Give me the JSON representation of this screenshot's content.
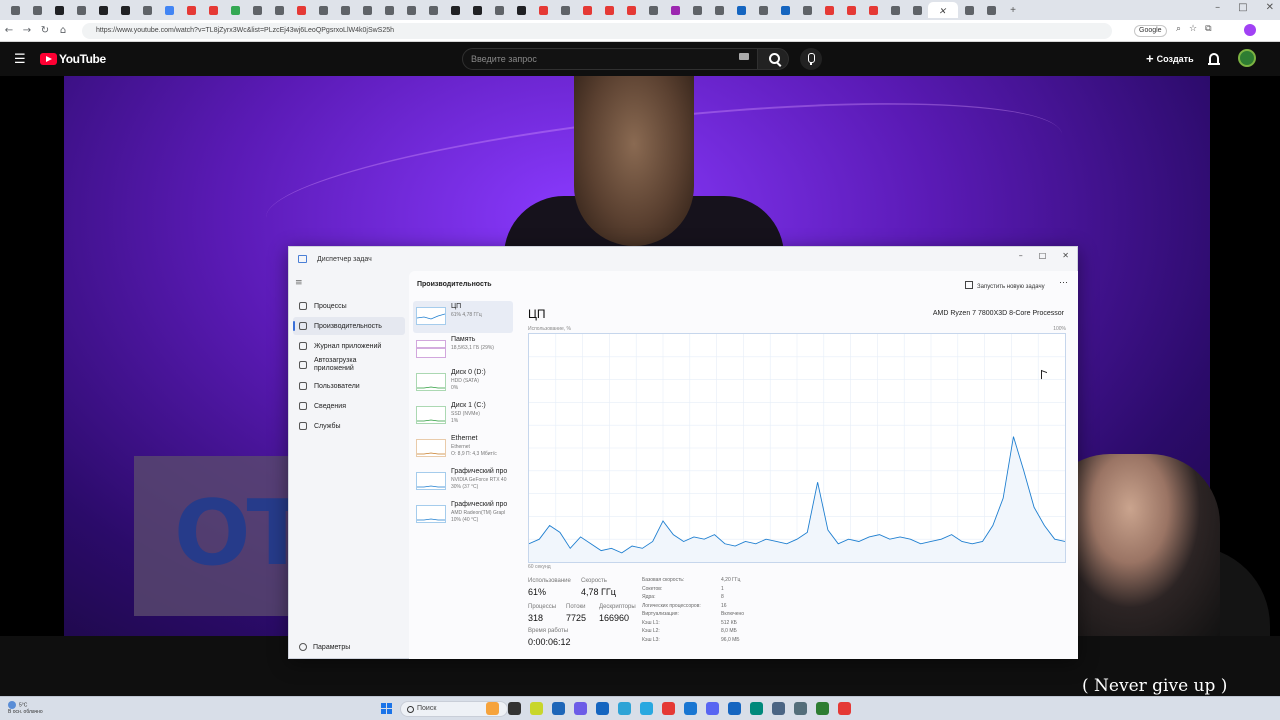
{
  "browser": {
    "url": "https://www.youtube.com/watch?v=TL8jZyrx3Wc&list=PLzcEj43wj6LeoQPgsrxoLlW4k0jSwS25h",
    "search_engine_chip": "Google",
    "tab_colors": [
      "#5f6368",
      "#5f6368",
      "#202124",
      "#5f6368",
      "#202124",
      "#202124",
      "#5f6368",
      "#4285f4",
      "#e53935",
      "#e53935",
      "#34a853",
      "#5f6368",
      "#5f6368",
      "#e53935",
      "#5f6368",
      "#5f6368",
      "#5f6368",
      "#5f6368",
      "#5f6368",
      "#5f6368",
      "#202124",
      "#202124",
      "#5f6368",
      "#202124",
      "#e53935",
      "#5f6368",
      "#e53935",
      "#e53935",
      "#e53935",
      "#5f6368",
      "#9c27b0",
      "#5f6368",
      "#5f6368",
      "#1565c0",
      "#5f6368",
      "#1565c0",
      "#5f6368",
      "#e53935",
      "#e53935",
      "#e53935",
      "#5f6368",
      "#5f6368",
      "#5f6368",
      "#5f6368",
      "#5f6368"
    ],
    "new_tab_label": "+"
  },
  "youtube": {
    "logo_text": "YouTube",
    "search_placeholder": "Введите запрос",
    "create_label": "Создать",
    "brand_color": "#ff0033"
  },
  "video": {
    "banner_text": "OT",
    "slogan": "( Never give up )"
  },
  "task_manager": {
    "title": "Диспетчер задач",
    "nav": [
      {
        "label": "Процессы",
        "icon": "processes-icon"
      },
      {
        "label": "Производительность",
        "icon": "performance-icon"
      },
      {
        "label": "Журнал приложений",
        "icon": "app-history-icon"
      },
      {
        "label": "Автозагрузка приложений",
        "icon": "startup-icon"
      },
      {
        "label": "Пользователи",
        "icon": "users-icon"
      },
      {
        "label": "Сведения",
        "icon": "details-icon"
      },
      {
        "label": "Службы",
        "icon": "services-icon"
      }
    ],
    "selected_nav": "Производительность",
    "settings_label": "Параметры",
    "panel_title": "Производительность",
    "new_task_label": "Запустить новую задачу",
    "devices": [
      {
        "name": "ЦП",
        "sub": "61% 4,78 ГГц",
        "color": "#1f7fd0"
      },
      {
        "name": "Память",
        "sub": "18,5/63,1 ГБ (29%)",
        "color": "#8e24aa"
      },
      {
        "name": "Диск 0 (D:)",
        "sub": "HDD (SATA)\n0%",
        "color": "#2e9e3e"
      },
      {
        "name": "Диск 1 (C:)",
        "sub": "SSD (NVMe)\n1%",
        "color": "#2e9e3e"
      },
      {
        "name": "Ethernet",
        "sub": "Ethernet\nО: 8,9 П: 4,3 Мбит/с",
        "color": "#c77d2a"
      },
      {
        "name": "Графический про",
        "sub": "NVIDIA GeForce RTX 40\n30% (37 °C)",
        "color": "#1f7fd0"
      },
      {
        "name": "Графический про",
        "sub": "AMD Radeon(TM) Grapl\n10% (40 °C)",
        "color": "#1f7fd0"
      }
    ],
    "cpu": {
      "heading": "ЦП",
      "model": "AMD Ryzen 7 7800X3D 8-Core Processor",
      "util_label": "Использование, %",
      "max_label": "100%",
      "time_label": "60 секунд",
      "usage_label": "Использование",
      "usage_value": "61%",
      "speed_label": "Скорость",
      "speed_value": "4,78 ГГц",
      "processes_label": "Процессы",
      "processes_value": "318",
      "threads_label": "Потоки",
      "threads_value": "7725",
      "handles_label": "Дескрипторы",
      "handles_value": "166960",
      "uptime_label": "Время работы",
      "uptime_value": "0:00:06:12",
      "specs": [
        {
          "k": "Базовая скорость:",
          "v": "4,20 ГГц"
        },
        {
          "k": "Сокетов:",
          "v": "1"
        },
        {
          "k": "Ядра:",
          "v": "8"
        },
        {
          "k": "Логических процессоров:",
          "v": "16"
        },
        {
          "k": "Виртуализация:",
          "v": "Включено"
        },
        {
          "k": "Кэш L1:",
          "v": "512 КБ"
        },
        {
          "k": "Кэш L2:",
          "v": "8,0 МБ"
        },
        {
          "k": "Кэш L3:",
          "v": "96,0 МБ"
        }
      ],
      "graph_series": [
        8,
        10,
        16,
        13,
        6,
        11,
        8,
        5,
        6,
        4,
        7,
        6,
        9,
        18,
        12,
        9,
        11,
        10,
        12,
        8,
        7,
        9,
        8,
        10,
        9,
        8,
        10,
        13,
        35,
        14,
        8,
        10,
        9,
        11,
        12,
        10,
        11,
        10,
        8,
        9,
        10,
        12,
        9,
        8,
        9,
        16,
        28,
        55,
        40,
        24,
        16,
        10,
        9
      ],
      "graph_color": "#1f7fd0"
    }
  },
  "taskbar": {
    "weather_temp": "5°C",
    "weather_desc": "В осн. облачно",
    "search_label": "Поиск",
    "app_colors": [
      "#f6a33c",
      "#333333",
      "#c8d62b",
      "#1e66b8",
      "#6c5ce7",
      "#1565c0",
      "#2ea3d6",
      "#28a8e0",
      "#e53935",
      "#1976d2",
      "#5865f2",
      "#1565c0",
      "#00897b",
      "#4b6584",
      "#546e7a",
      "#2e7d32",
      "#e53935"
    ]
  }
}
